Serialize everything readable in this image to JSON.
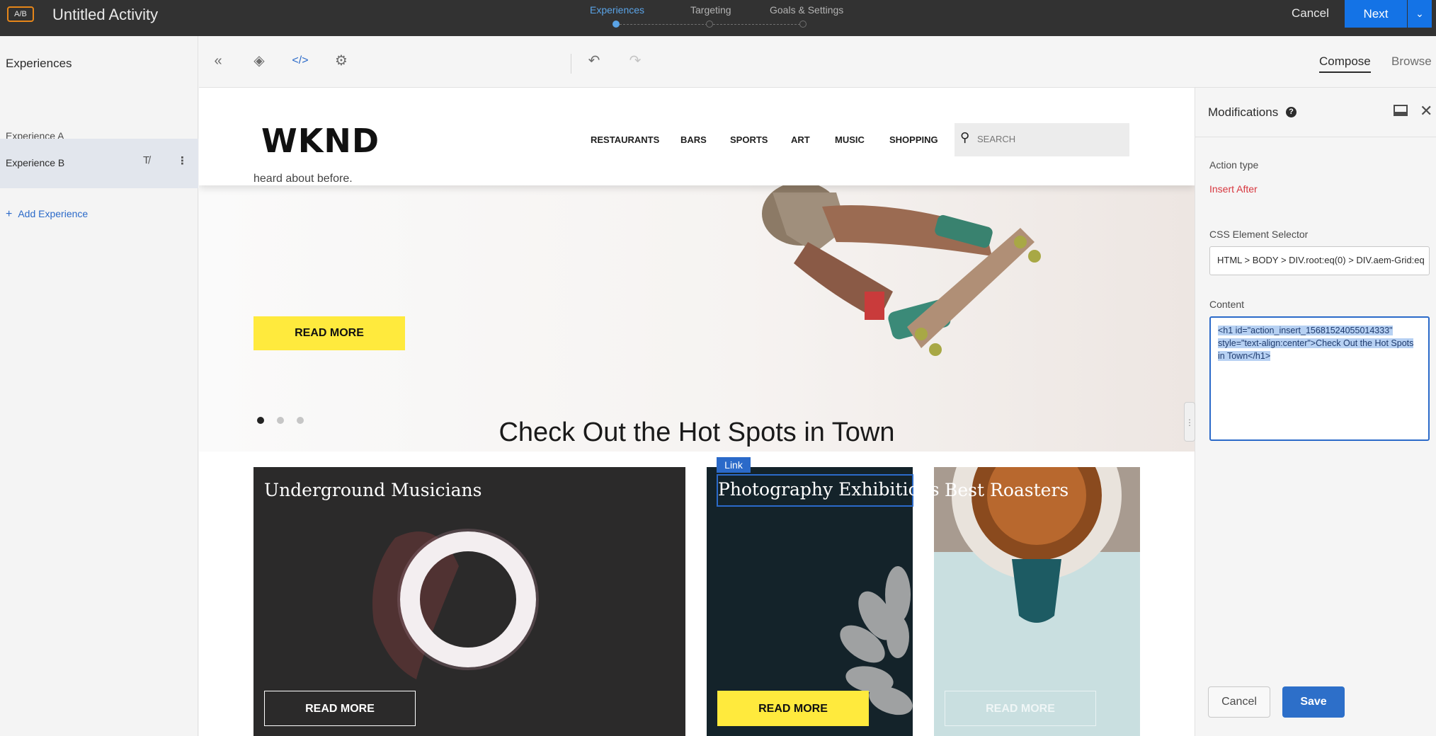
{
  "header": {
    "badge": "A/B",
    "title": "Untitled Activity",
    "steps": [
      {
        "label": "Experiences",
        "active": true
      },
      {
        "label": "Targeting",
        "active": false
      },
      {
        "label": "Goals & Settings",
        "active": false
      }
    ],
    "cancel_label": "Cancel",
    "next_label": "Next",
    "accent_color": "#1473e6"
  },
  "sidebar": {
    "title": "Experiences",
    "experiences": [
      {
        "label": "Experience A"
      },
      {
        "label": "Experience B"
      }
    ],
    "add_label": "Add Experience"
  },
  "toolbar": {
    "icons": [
      "collapse-icon",
      "layers-icon",
      "code-icon",
      "gear-icon",
      "undo-icon",
      "redo-icon"
    ],
    "compose_label": "Compose",
    "browse_label": "Browse"
  },
  "site": {
    "logo": "WKND",
    "nav": [
      "RESTAURANTS",
      "BARS",
      "SPORTS",
      "ART",
      "MUSIC",
      "SHOPPING"
    ],
    "search_placeholder": "SEARCH",
    "hero_text": "heard about before.",
    "hero_button": "READ MORE",
    "section_title": "Check Out the Hot Spots in Town",
    "cards": [
      {
        "title": "Underground Musicians",
        "button": "READ MORE"
      },
      {
        "title": "Photography Exhibitions",
        "button": "READ MORE"
      },
      {
        "title": "Best Roasters",
        "button": "READ MORE"
      }
    ],
    "link_tag": "Link"
  },
  "panel": {
    "title": "Modifications",
    "action_type_label": "Action type",
    "action_type_value": "Insert After",
    "selector_label": "CSS Element Selector",
    "selector_value": "HTML > BODY > DIV.root:eq(0) > DIV.aem-Grid:eq",
    "content_label": "Content",
    "content_value": "<h1 id=\"action_insert_15681524055014333\" style=\"text-align:center\">Check Out the Hot Spots in Town</h1>",
    "cancel_label": "Cancel",
    "save_label": "Save"
  }
}
